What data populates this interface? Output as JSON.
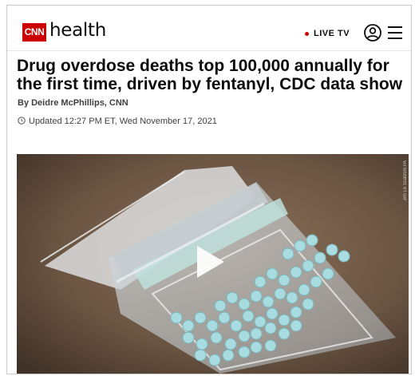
{
  "header": {
    "logo_text": "CNN",
    "section": "health",
    "live_tv": "LIVE TV",
    "brand_color": "#cc0000",
    "icons": [
      "account-icon",
      "menu-icon"
    ]
  },
  "article": {
    "headline": "Drug overdose deaths top 100,000 annually for the first time, driven by fentanyl, CDC data show",
    "byline": "By Deidre McPhillips, CNN",
    "timestamp": "Updated 12:27 PM ET, Wed November 17, 2021"
  },
  "media": {
    "type": "video",
    "icons": [
      "play-icon"
    ],
    "photo_credit": "Jim Lo Scalzo/EPA"
  }
}
